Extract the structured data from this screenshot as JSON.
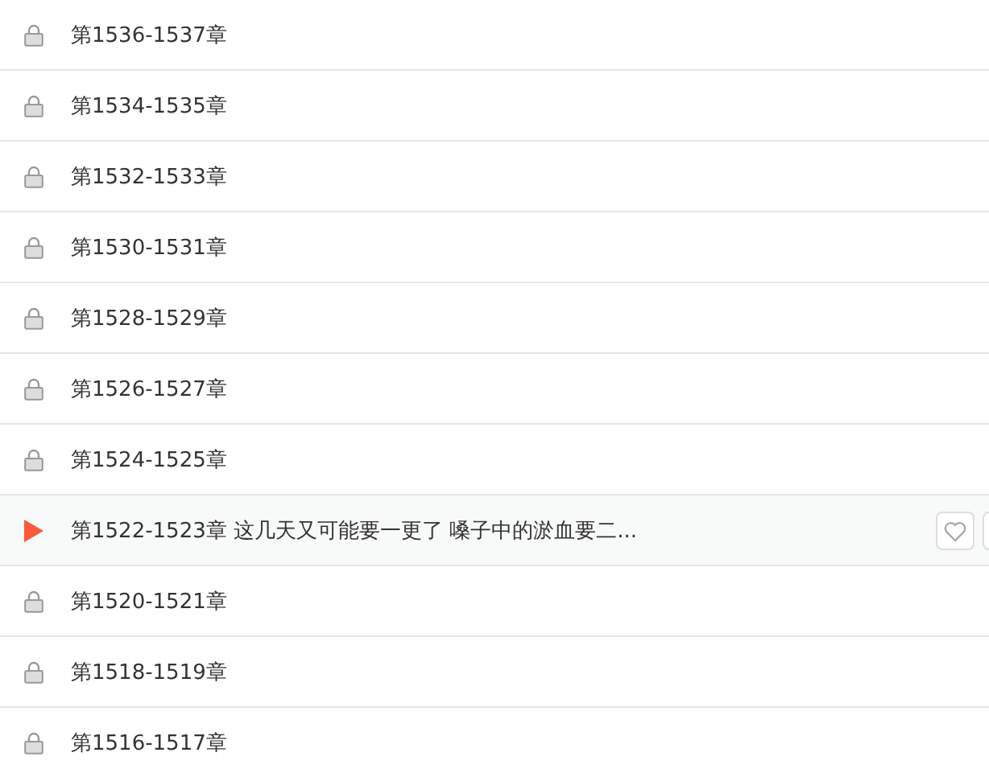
{
  "chapters": [
    {
      "title": "第1536-1537章",
      "kind": "locked"
    },
    {
      "title": "第1534-1535章",
      "kind": "locked"
    },
    {
      "title": "第1532-1533章",
      "kind": "locked"
    },
    {
      "title": "第1530-1531章",
      "kind": "locked"
    },
    {
      "title": "第1528-1529章",
      "kind": "locked"
    },
    {
      "title": "第1526-1527章",
      "kind": "locked"
    },
    {
      "title": "第1524-1525章",
      "kind": "locked"
    },
    {
      "title": "第1522-1523章 这几天又可能要一更了 嗓子中的淤血要二...",
      "kind": "playing"
    },
    {
      "title": "第1520-1521章",
      "kind": "locked"
    },
    {
      "title": "第1518-1519章",
      "kind": "locked"
    },
    {
      "title": "第1516-1517章",
      "kind": "locked"
    }
  ]
}
